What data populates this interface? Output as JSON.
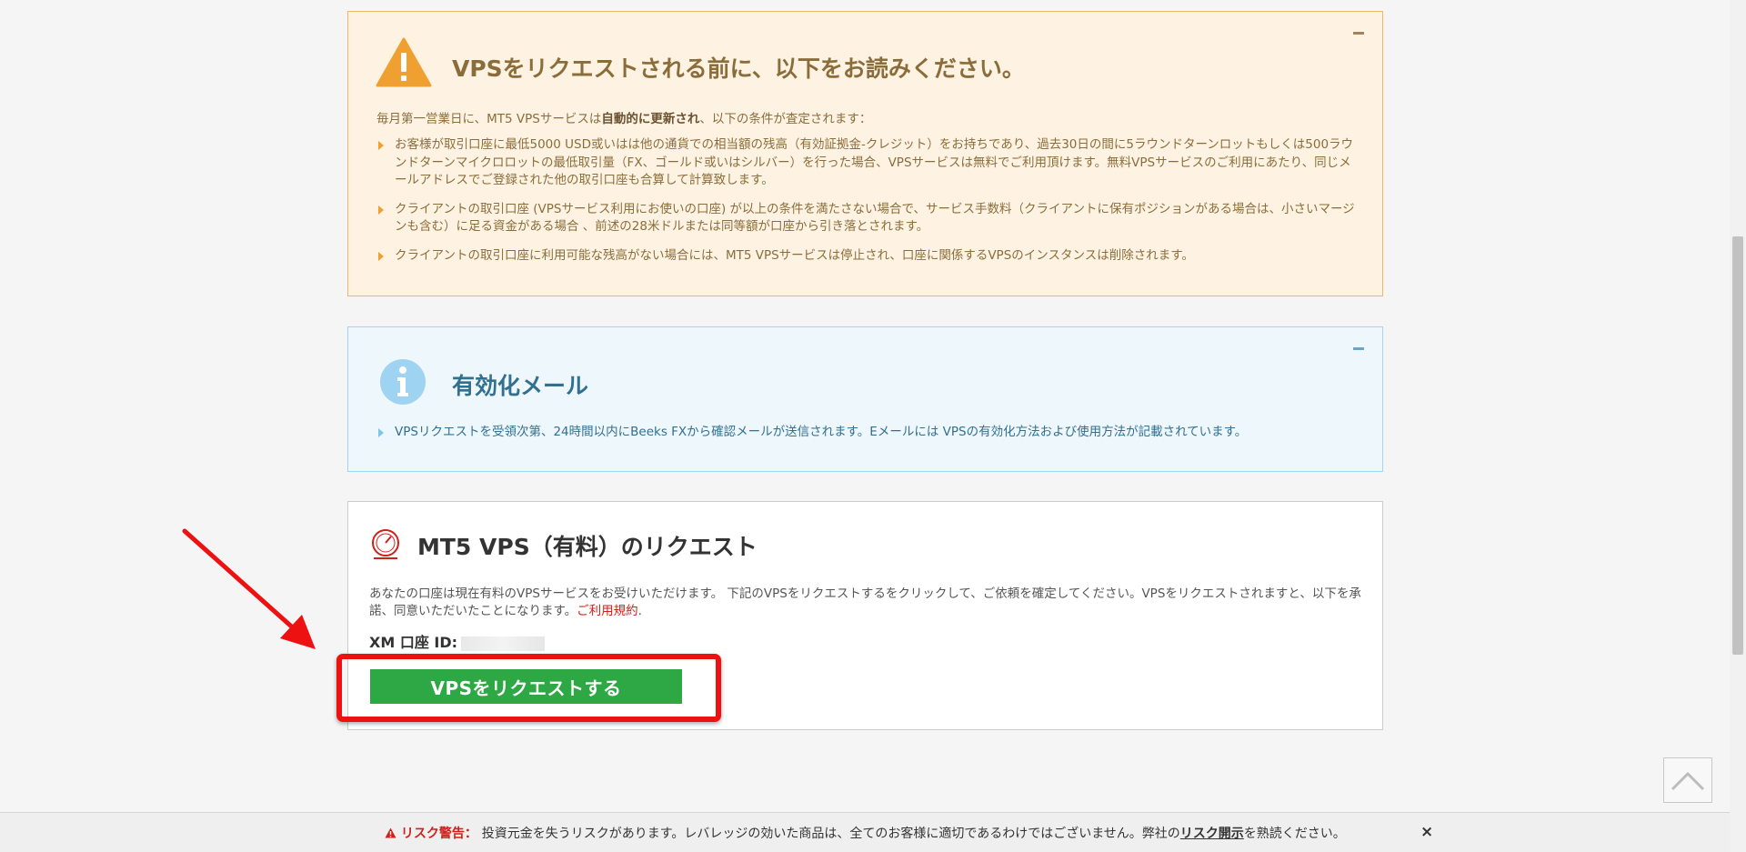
{
  "warning_panel": {
    "title": "VPSをリクエストされる前に、以下をお読みください。",
    "intro_prefix": "毎月第一営業日に、MT5 VPSサービスは",
    "intro_bold": "自動的に更新され",
    "intro_suffix": "、以下の条件が査定されます：",
    "bullets": [
      "お客様が取引口座に最低5000 USD或いはは他の通貨での相当額の残高（有効証拠金-クレジット）をお持ちであり、過去30日の間に5ラウンドターンロットもしくは500ラウンドターンマイクロロットの最低取引量（FX、ゴールド或いはシルバー）を行った場合、VPSサービスは無料でご利用頂けます。無料VPSサービスのご利用にあたり、同じメールアドレスでご登録された他の取引口座も合算して計算致します。",
      "クライアントの取引口座 (VPSサービス利用にお使いの口座) が以上の条件を満たさない場合で、サービス手数料（クライアントに保有ポジションがある場合は、小さいマージンも含む）に足る資金がある場合 、前述の28米ドルまたは同等額が口座から引き落とされます。",
      "クライアントの取引口座に利用可能な残高がない場合には、MT5 VPSサービスは停止され、口座に関係するVPSのインスタンスは削除されます。"
    ],
    "icon": "warning-triangle-icon",
    "accent_color": "#f0a030"
  },
  "info_panel": {
    "title": "有効化メール",
    "bullets": [
      "VPSリクエストを受領次第、24時間以内にBeeks FXから確認メールが送信されます。Eメールには VPSの有効化方法および使用方法が記載されています。"
    ],
    "icon": "info-icon",
    "accent_color": "#7fc4ea"
  },
  "request_panel": {
    "title": "MT5 VPS（有料）のリクエスト",
    "description": "あなたの口座は現在有料のVPSサービスをお受けいただけます。 下記のVPSをリクエストするをクリックして、ご依頼を確定してください。VPSをリクエストされますと、以下を承諾、同意いただいたことになります。",
    "terms_link": "ご利用規約",
    "terms_suffix": ".",
    "account_label": "XM 口座 ID:",
    "button_label": "VPSをリクエストする",
    "button_color": "#2ea844",
    "icon": "gauge-icon"
  },
  "annotation": {
    "highlight_color": "#ee1111"
  },
  "risk_bar": {
    "label": "リスク警告：",
    "text": " 投資元金を失うリスクがあります。レバレッジの効いた商品は、全てのお客様に適切であるわけではございません。弊社の",
    "link": "リスク開示",
    "suffix": "を熟読ください。",
    "close": "×"
  }
}
